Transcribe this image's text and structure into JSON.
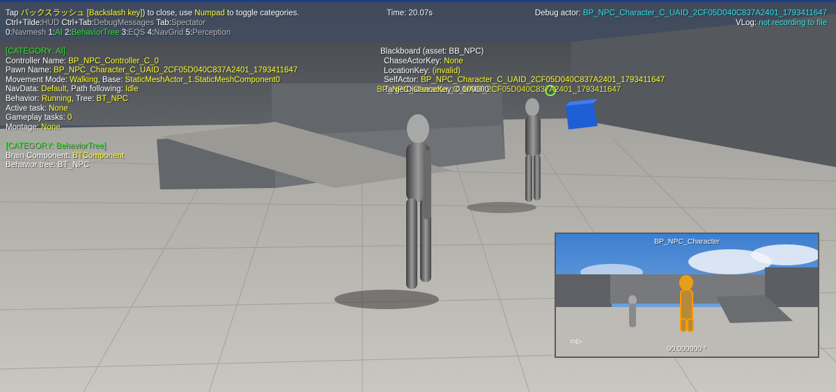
{
  "header": {
    "line1": [
      {
        "text": "Tap ",
        "color": "w"
      },
      {
        "text": "バックスラッシュ [Backslash key]",
        "color": "y"
      },
      {
        "text": ") to close, use ",
        "color": "w"
      },
      {
        "text": "Numpad",
        "color": "y"
      },
      {
        "text": " to toggle categories.",
        "color": "w"
      }
    ],
    "line2": [
      {
        "text": "Ctrl+Tilde:",
        "color": "w"
      },
      {
        "text": "HUD",
        "color": "gr"
      },
      {
        "text": "  Ctrl+Tab:",
        "color": "w"
      },
      {
        "text": "DebugMessages",
        "color": "gr"
      },
      {
        "text": "  Tab:",
        "color": "w"
      },
      {
        "text": "Spectator",
        "color": "gr"
      }
    ],
    "line3": [
      {
        "text": "0:",
        "color": "w"
      },
      {
        "text": "Navmesh",
        "color": "gr"
      },
      {
        "text": "  1:",
        "color": "w"
      },
      {
        "text": "AI",
        "color": "g"
      },
      {
        "text": "  2:",
        "color": "w"
      },
      {
        "text": "BehaviorTree",
        "color": "g"
      },
      {
        "text": "  3:",
        "color": "w"
      },
      {
        "text": "EQS",
        "color": "gr"
      },
      {
        "text": "  4:",
        "color": "w"
      },
      {
        "text": "NavGrid",
        "color": "gr"
      },
      {
        "text": "  5:",
        "color": "w"
      },
      {
        "text": "Perception",
        "color": "gr"
      }
    ],
    "time": "Time: 20.07s",
    "debug_actor_label": "Debug actor: ",
    "debug_actor_value": "BP_NPC_Character_C_UAID_2CF05D040C837A2401_1793411647",
    "vlog_label": "VLog: ",
    "vlog_value": "not recording to file"
  },
  "ai_panel": {
    "category_ai": "[CATEGORY: AI]",
    "lines": [
      [
        {
          "text": "Controller Name: ",
          "color": "w"
        },
        {
          "text": "BP_NPC_Controller_C_0",
          "color": "y"
        }
      ],
      [
        {
          "text": "Pawn Name: ",
          "color": "w"
        },
        {
          "text": "BP_NPC_Character_C_UAID_2CF05D040C837A2401_1793411647",
          "color": "y"
        }
      ],
      [
        {
          "text": "Movement Mode: ",
          "color": "w"
        },
        {
          "text": "Walking",
          "color": "y"
        },
        {
          "text": ", Base: ",
          "color": "w"
        },
        {
          "text": "StaticMeshActor_1.StaticMeshComponent0",
          "color": "y"
        }
      ],
      [
        {
          "text": "NavData: ",
          "color": "w"
        },
        {
          "text": "Default",
          "color": "y"
        },
        {
          "text": ", Path following: ",
          "color": "w"
        },
        {
          "text": "Idle",
          "color": "y"
        }
      ],
      [
        {
          "text": "Behavior: ",
          "color": "w"
        },
        {
          "text": "Running",
          "color": "y"
        },
        {
          "text": ", Tree: ",
          "color": "w"
        },
        {
          "text": "BT_NPC",
          "color": "y"
        }
      ],
      [
        {
          "text": "Active task: ",
          "color": "w"
        },
        {
          "text": "None",
          "color": "y"
        }
      ],
      [
        {
          "text": "Gameplay tasks: ",
          "color": "w"
        },
        {
          "text": "0",
          "color": "y"
        }
      ],
      [
        {
          "text": "Montage: ",
          "color": "w"
        },
        {
          "text": "None",
          "color": "y"
        }
      ]
    ],
    "category_bt": "[CATEGORY: BehaviorTree]",
    "bt_lines": [
      [
        {
          "text": "Brain Component: ",
          "color": "w"
        },
        {
          "text": "BTComponent",
          "color": "y"
        }
      ],
      [
        {
          "text": "Behavior tree: BT_NPC",
          "color": "w"
        }
      ]
    ]
  },
  "blackboard": {
    "title": "Blackboard (asset: BB_NPC)",
    "lines": [
      [
        {
          "text": "ChaseActorKey: ",
          "color": "w"
        },
        {
          "text": "None",
          "color": "y"
        }
      ],
      [
        {
          "text": "LocationKey: ",
          "color": "w"
        },
        {
          "text": "(invalid)",
          "color": "y"
        }
      ],
      [
        {
          "text": "SelfActor: ",
          "color": "w"
        },
        {
          "text": "BP_NPC_Character_C_UAID_2CF05D040C837A2401_1793411647",
          "color": "y"
        }
      ],
      [
        {
          "text": "TargetDistanceKey: 0.000000",
          "color": "w"
        }
      ]
    ],
    "overlap_label": "BP_NPC_Character_C_UAID_2CF05D040C837A2401_1793411647"
  },
  "pip": {
    "title": "BP_NPC_Character",
    "fov": "90.000000 °",
    "camera_icon": "camera-icon"
  },
  "colors": {
    "yellow": "#ffff33",
    "green": "#33e533",
    "gray": "#b8b8b8",
    "cyan": "#33e6e6",
    "cube": "#1f5fd6"
  }
}
